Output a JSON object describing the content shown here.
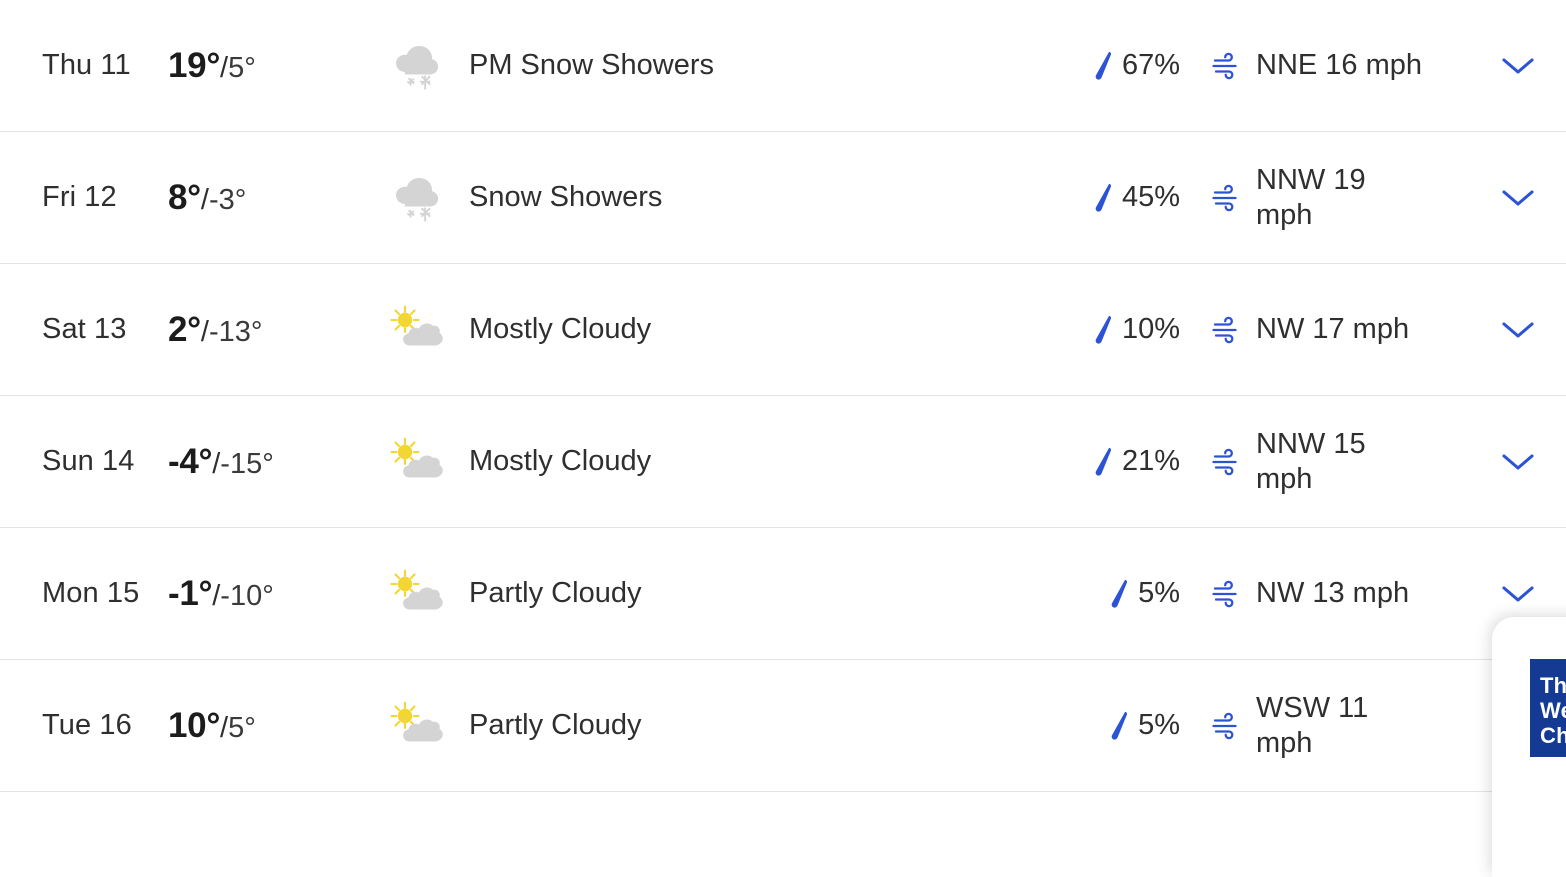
{
  "accent_color": "#2c53d4",
  "cloud_color": "#d4d4d4",
  "sun_color": "#f2d734",
  "separator_color": "#e3e3e3",
  "forecast": {
    "rows": [
      {
        "day": "Thu 11",
        "high": "19°",
        "sep": "/",
        "low": "5°",
        "icon": "snow-showers-icon",
        "condition": "PM Snow Showers",
        "precip": "67%",
        "wind": "NNE 16 mph",
        "wind_wraps": false
      },
      {
        "day": "Fri 12",
        "high": "8°",
        "sep": "/",
        "low": "-3°",
        "icon": "snow-showers-icon",
        "condition": "Snow Showers",
        "precip": "45%",
        "wind": "NNW 19 mph",
        "wind_wraps": true
      },
      {
        "day": "Sat 13",
        "high": "2°",
        "sep": "/",
        "low": "-13°",
        "icon": "partly-cloudy-icon",
        "condition": "Mostly Cloudy",
        "precip": "10%",
        "wind": "NW 17 mph",
        "wind_wraps": false
      },
      {
        "day": "Sun 14",
        "high": "-4°",
        "sep": "/",
        "low": "-15°",
        "icon": "partly-cloudy-icon",
        "condition": "Mostly Cloudy",
        "precip": "21%",
        "wind": "NNW 15 mph",
        "wind_wraps": true
      },
      {
        "day": "Mon 15",
        "high": "-1°",
        "sep": "/",
        "low": "-10°",
        "icon": "partly-cloudy-icon",
        "condition": "Partly Cloudy",
        "precip": "5%",
        "wind": "NW 13 mph",
        "wind_wraps": false
      },
      {
        "day": "Tue 16",
        "high": "10°",
        "sep": "/",
        "low": "5°",
        "icon": "partly-cloudy-icon",
        "condition": "Partly Cloudy",
        "precip": "5%",
        "wind": "WSW 11 mph",
        "wind_wraps": true
      }
    ]
  },
  "promo": {
    "logo_line1": "The",
    "logo_line2": "We",
    "logo_line3": "Cha"
  }
}
